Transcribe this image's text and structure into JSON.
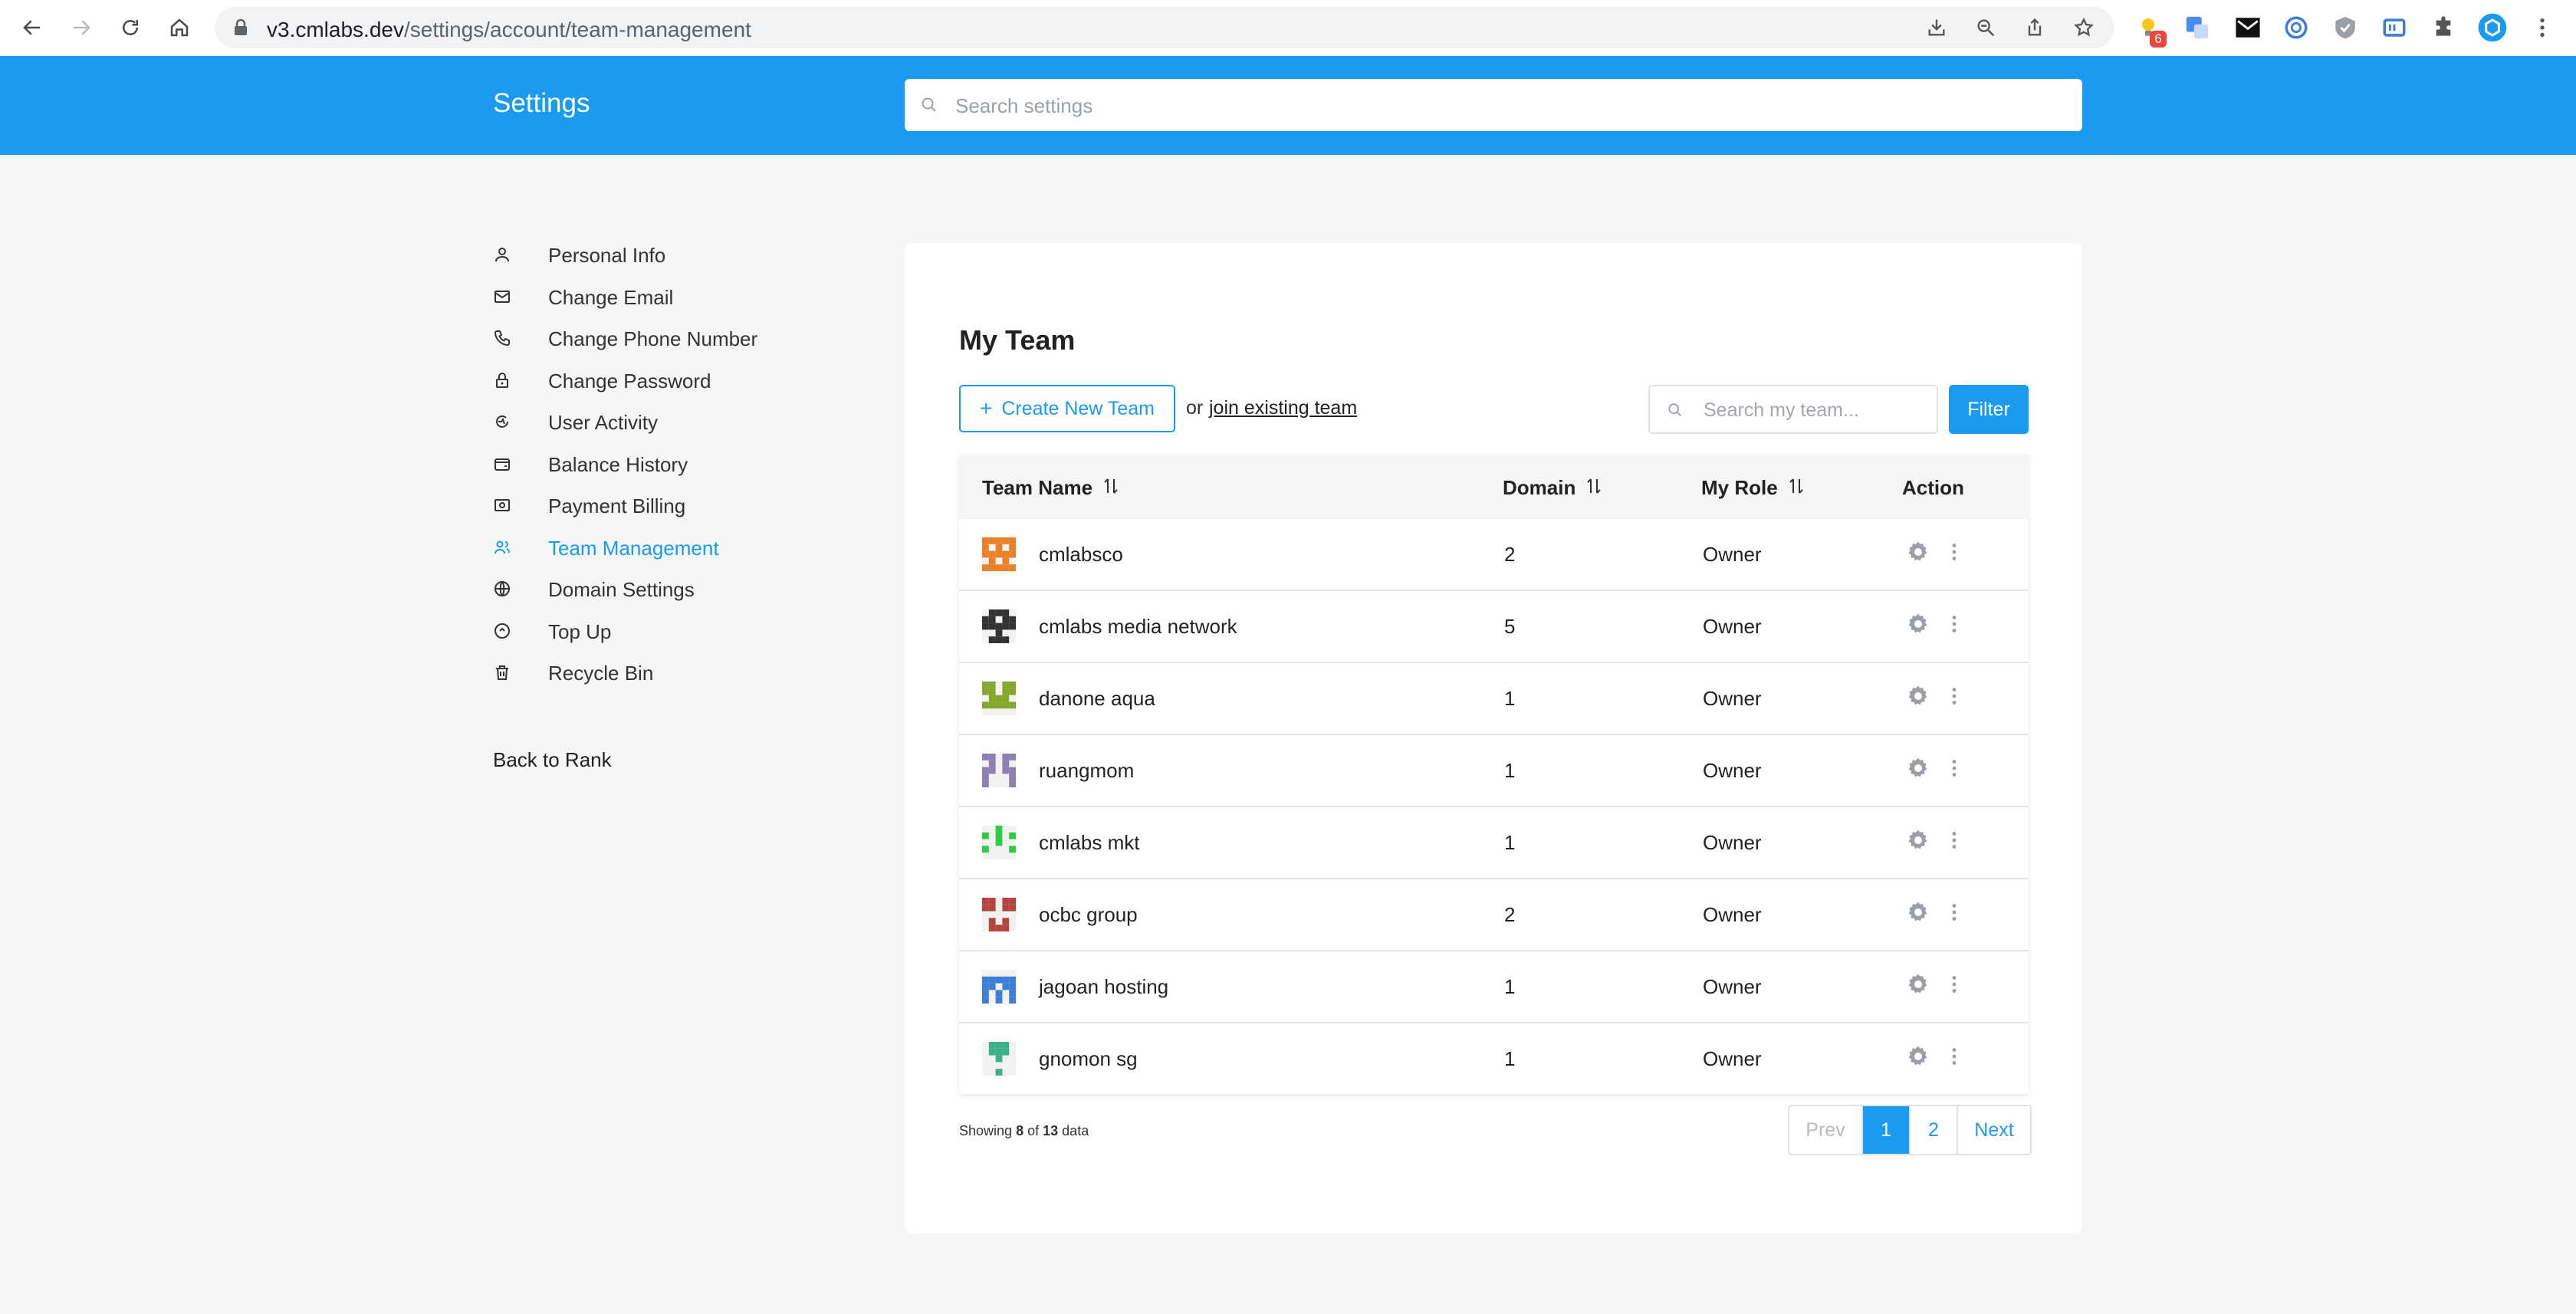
{
  "browser": {
    "url_host": "v3.cmlabs.dev",
    "url_path": "/settings/account/team-management",
    "extension_badge": "6"
  },
  "header": {
    "title": "Settings",
    "search_placeholder": "Search settings"
  },
  "sidebar": {
    "items": [
      {
        "label": "Personal Info",
        "icon": "user-icon"
      },
      {
        "label": "Change Email",
        "icon": "mail-icon"
      },
      {
        "label": "Change Phone Number",
        "icon": "phone-icon"
      },
      {
        "label": "Change Password",
        "icon": "lock-icon"
      },
      {
        "label": "User Activity",
        "icon": "activity-icon"
      },
      {
        "label": "Balance History",
        "icon": "wallet-icon"
      },
      {
        "label": "Payment Billing",
        "icon": "billing-icon"
      },
      {
        "label": "Team Management",
        "icon": "team-icon",
        "active": true
      },
      {
        "label": "Domain Settings",
        "icon": "globe-icon"
      },
      {
        "label": "Top Up",
        "icon": "topup-icon"
      },
      {
        "label": "Recycle Bin",
        "icon": "trash-icon"
      }
    ],
    "back_label": "Back to Rank"
  },
  "main": {
    "title": "My Team",
    "create_label": "Create New Team",
    "or_text": "or",
    "join_label": "join existing team",
    "search_placeholder": "Search my team...",
    "filter_label": "Filter",
    "columns": {
      "team_name": "Team Name",
      "domain": "Domain",
      "role": "My Role",
      "action": "Action"
    },
    "rows": [
      {
        "name": "cmlabsco",
        "domain": "2",
        "role": "Owner",
        "color": "#e8812a"
      },
      {
        "name": "cmlabs media network",
        "domain": "5",
        "role": "Owner",
        "color": "#333333"
      },
      {
        "name": "danone aqua",
        "domain": "1",
        "role": "Owner",
        "color": "#86a62c"
      },
      {
        "name": "ruangmom",
        "domain": "1",
        "role": "Owner",
        "color": "#8e7fb3"
      },
      {
        "name": "cmlabs mkt",
        "domain": "1",
        "role": "Owner",
        "color": "#2ecc40"
      },
      {
        "name": "ocbc group",
        "domain": "2",
        "role": "Owner",
        "color": "#b5443f"
      },
      {
        "name": "jagoan hosting",
        "domain": "1",
        "role": "Owner",
        "color": "#3d7fd6"
      },
      {
        "name": "gnomon sg",
        "domain": "1",
        "role": "Owner",
        "color": "#3cb08a"
      }
    ],
    "showing": {
      "prefix": "Showing",
      "shown": "8",
      "of": "of",
      "total": "13",
      "suffix": "data"
    },
    "pagination": {
      "prev": "Prev",
      "pages": [
        "1",
        "2"
      ],
      "current": "1",
      "next": "Next"
    }
  },
  "colors": {
    "accent": "#1a9bf0",
    "background": "#f5f6f8"
  }
}
